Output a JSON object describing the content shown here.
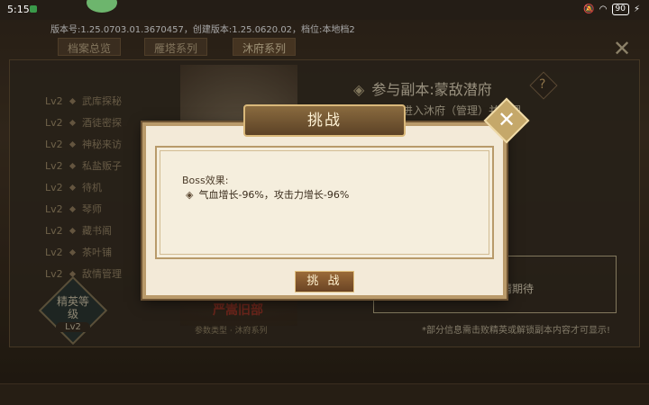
{
  "status_bar": {
    "time": "5:15",
    "battery": "90"
  },
  "version_text": "版本号:1.25.0703.01.3670457，创建版本:1.25.0620.02，档位:本地档2",
  "tabs": [
    {
      "label": "档案总览"
    },
    {
      "label": "雁塔系列"
    },
    {
      "label": "沐府系列"
    }
  ],
  "side_list": [
    {
      "lv": "Lv2",
      "name": "武库探秘"
    },
    {
      "lv": "Lv2",
      "name": "酒徒密探"
    },
    {
      "lv": "Lv2",
      "name": "神秘来访"
    },
    {
      "lv": "Lv2",
      "name": "私盐贩子"
    },
    {
      "lv": "Lv2",
      "name": "待机"
    },
    {
      "lv": "Lv2",
      "name": "琴师"
    },
    {
      "lv": "Lv2",
      "name": "藏书阁"
    },
    {
      "lv": "Lv2",
      "name": "茶叶铺"
    },
    {
      "lv": "Lv2",
      "name": "敌情管理"
    }
  ],
  "elite": {
    "label": "精英等级",
    "level": "Lv2"
  },
  "portrait": {
    "name": "严嵩旧部",
    "sub": "参数类型 · 沐府系列"
  },
  "raid": {
    "title": "参与副本:蒙敌潜府",
    "subtitle": "需要进入沐府（管理）并管理",
    "awaiting": "请期待",
    "note": "*部分信息需击败精英或解锁副本内容才可显示!"
  },
  "dialog": {
    "title": "挑战",
    "boss_label": "Boss效果:",
    "boss_effect": "气血增长-96%，攻击力增长-96%",
    "button": "挑 战"
  },
  "colors": {
    "accent": "#b99a6a",
    "dialog_bg": "#f3ead8",
    "button": "#6a4424"
  }
}
